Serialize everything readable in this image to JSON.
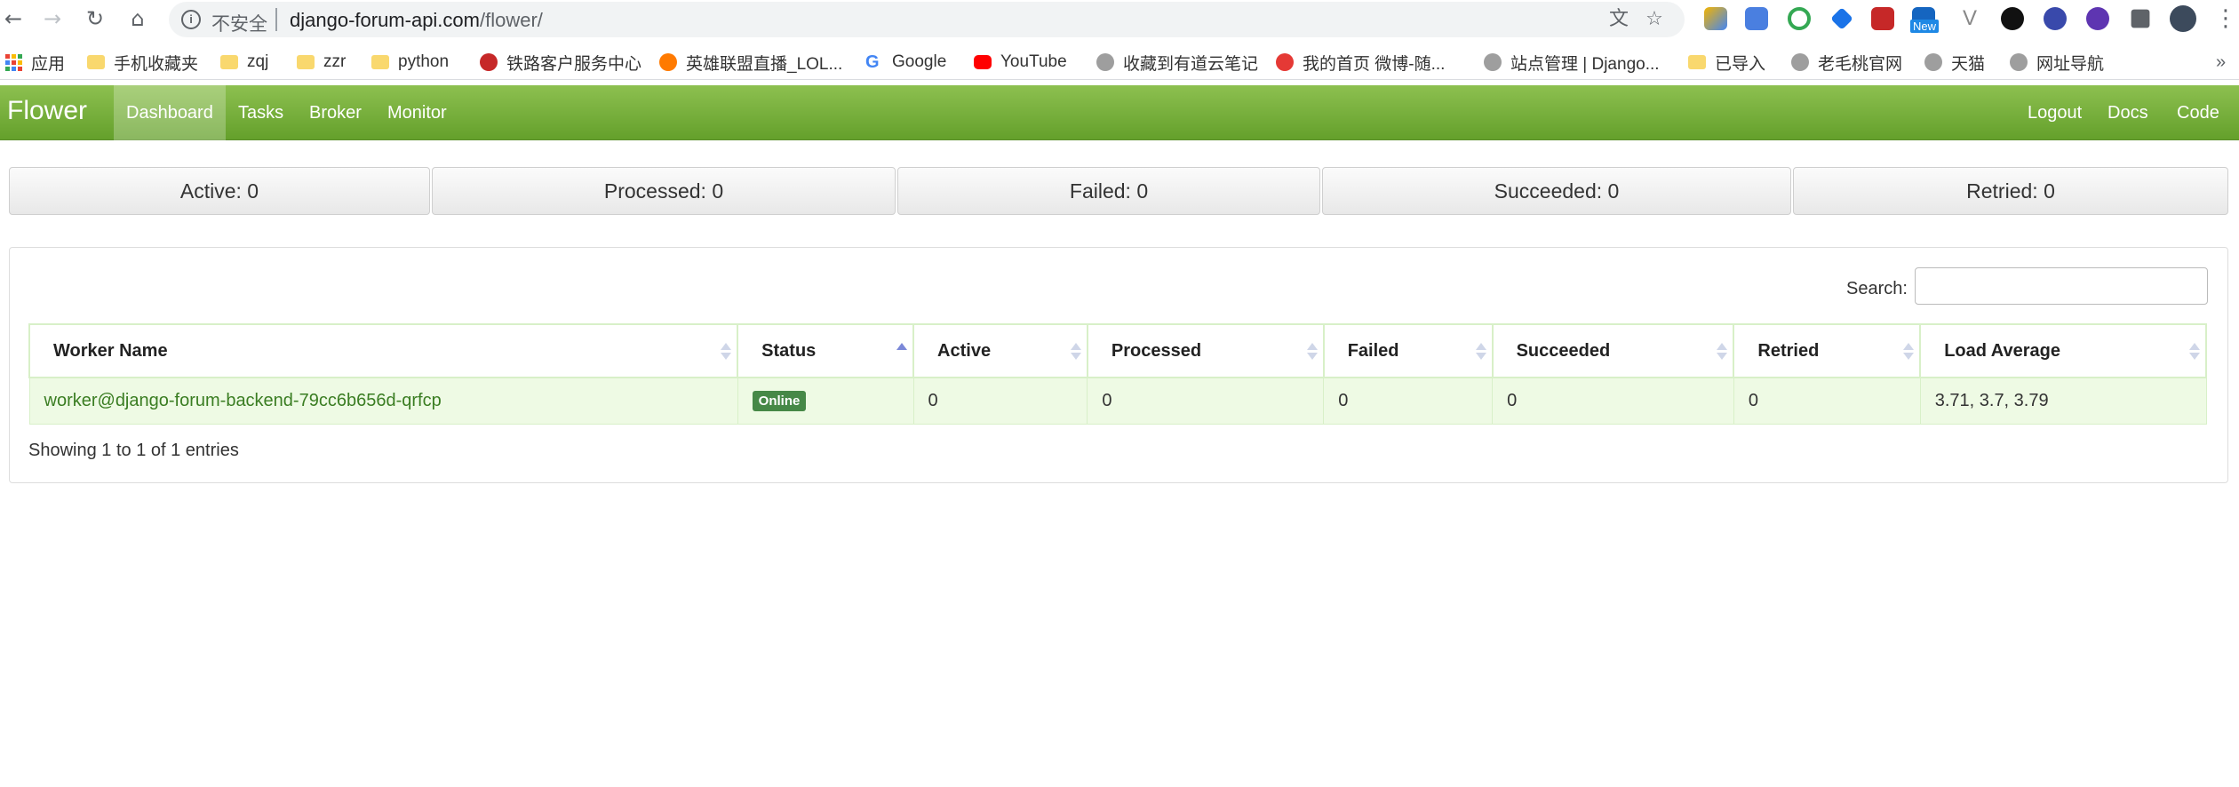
{
  "browser": {
    "insecure_label": "不安全",
    "url_host": "django-forum-api.com",
    "url_path": "/flower/",
    "new_badge": "New"
  },
  "bookmarks": [
    {
      "label": "应用",
      "icon": "apps-grid-icon"
    },
    {
      "label": "手机收藏夹",
      "icon": "folder-icon"
    },
    {
      "label": "zqj",
      "icon": "folder-icon"
    },
    {
      "label": "zzr",
      "icon": "folder-icon"
    },
    {
      "label": "python",
      "icon": "folder-icon"
    },
    {
      "label": "铁路客户服务中心",
      "icon": "railway-icon"
    },
    {
      "label": "英雄联盟直播_LOL...",
      "icon": "douyu-icon"
    },
    {
      "label": "Google",
      "icon": "google-icon"
    },
    {
      "label": "YouTube",
      "icon": "youtube-icon"
    },
    {
      "label": "收藏到有道云笔记",
      "icon": "globe-icon"
    },
    {
      "label": "我的首页 微博-随...",
      "icon": "weibo-icon"
    },
    {
      "label": "站点管理 | Django...",
      "icon": "globe-icon"
    },
    {
      "label": "已导入",
      "icon": "folder-icon"
    },
    {
      "label": "老毛桃官网",
      "icon": "globe-icon"
    },
    {
      "label": "天猫",
      "icon": "globe-icon"
    },
    {
      "label": "网址导航",
      "icon": "globe-icon"
    }
  ],
  "navbar": {
    "brand": "Flower",
    "left_items": [
      "Dashboard",
      "Tasks",
      "Broker",
      "Monitor"
    ],
    "active": "Dashboard",
    "right_items": [
      "Logout",
      "Docs",
      "Code"
    ]
  },
  "counters": [
    "Active: 0",
    "Processed: 0",
    "Failed: 0",
    "Succeeded: 0",
    "Retried: 0"
  ],
  "search": {
    "label": "Search:",
    "value": ""
  },
  "table": {
    "columns": [
      "Worker Name",
      "Status",
      "Active",
      "Processed",
      "Failed",
      "Succeeded",
      "Retried",
      "Load Average"
    ],
    "sorted_column": "Status",
    "rows": [
      {
        "worker_name": "worker@django-forum-backend-79cc6b656d-qrfcp",
        "status": "Online",
        "active": "0",
        "processed": "0",
        "failed": "0",
        "succeeded": "0",
        "retried": "0",
        "load_average": "3.71, 3.7, 3.79"
      }
    ]
  },
  "info": "Showing 1 to 1 of 1 entries"
}
